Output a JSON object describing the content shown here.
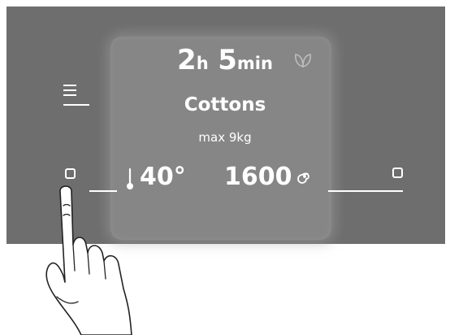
{
  "display": {
    "time_hours": "2",
    "time_hours_unit": "h",
    "time_minutes": "5",
    "time_minutes_unit": "min",
    "program": "Cottons",
    "load": "max 9kg",
    "temperature": "40°",
    "spin_speed": "1600"
  },
  "icons": {
    "eco": "leaf-icon",
    "menu": "menu-icon",
    "temperature": "thermometer-icon",
    "spin": "spin-icon",
    "hand": "pointing-hand-icon"
  },
  "colors": {
    "panel": "#6e6e6e",
    "screen": "#868686",
    "text": "#ffffff"
  }
}
